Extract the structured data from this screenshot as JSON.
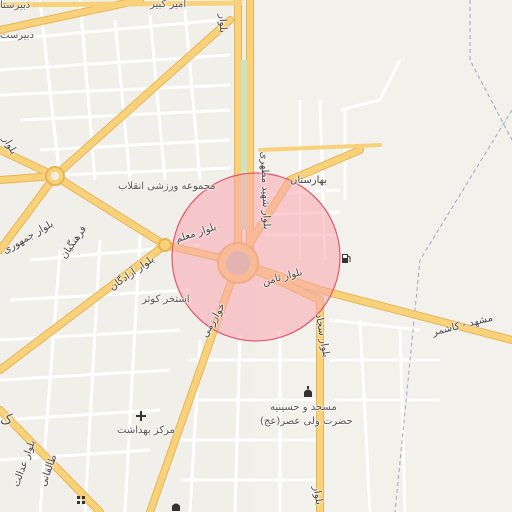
{
  "map": {
    "labels": {
      "amir_kabir": "امیر کبیر",
      "dabirestan": "دبیرست",
      "dabirestan2": "دبیرستا",
      "majmooe": "مجموعه ورزشی انقلاب",
      "baharestan": "بهارستان",
      "bolvar_moallem": "بلوار معلم",
      "bolvar_samen": "بلوار ثامن",
      "bolvar_azadegan": "بلوار آزادگان",
      "farhangian": "فرهنگیان",
      "bolvar_jomhoori": "بلوار جمهوری",
      "estakhr_kowsar": "استخر کوثر",
      "kharrazmi": "خوارزمی",
      "bolvar_sajjad": "بلوار سجاد",
      "mashhad_kashmar": "مشهد - کاشمر",
      "masjed": "مسجد و حسینیه",
      "hazrat": "حضرت ولی عصر(عج)",
      "markaz": "مرکز بهداشت",
      "taleghani": "طالقانی",
      "bolvar_edalat": "بلوار عدالت",
      "bolvar_motahhari": "بلوار شهید مطهری",
      "bolvar_left": "بلوار",
      "bolvar_top": "بلوار",
      "bolvar_bottom": "بلوار",
      "kaf": "ک"
    },
    "icons": {
      "fuel": "fuel-station-icon",
      "mosque": "mosque-icon",
      "health": "health-center-icon",
      "school": "school-icon"
    },
    "colors": {
      "background": "#f1efea",
      "road_major": "#f8d27a",
      "road_major_edge": "#e8b452",
      "road_minor": "#ffffff",
      "highlight_fill": "#f7a6ae",
      "highlight_stroke": "#e05a6a",
      "rail": "#9aa8c8"
    }
  }
}
